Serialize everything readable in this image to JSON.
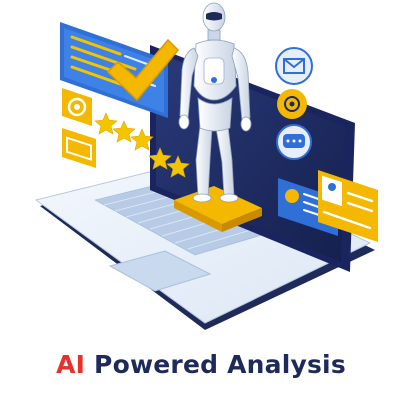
{
  "caption": {
    "accent": "AI",
    "main": " Powered Analysis"
  },
  "colors": {
    "accent_red": "#e5322d",
    "navy": "#1e2a5a",
    "blue": "#2f6fd6",
    "yellow": "#f5b800",
    "orange": "#f08a1c",
    "light_blue": "#cfe2f7"
  },
  "icons": {
    "hero": "humanoid-robot",
    "panels": [
      "document-chart",
      "checkmark",
      "star-rating",
      "mail-icon",
      "gear-icon",
      "chat-icon",
      "robot-icon",
      "user-profile-card"
    ]
  },
  "rating": {
    "stars": 5
  }
}
